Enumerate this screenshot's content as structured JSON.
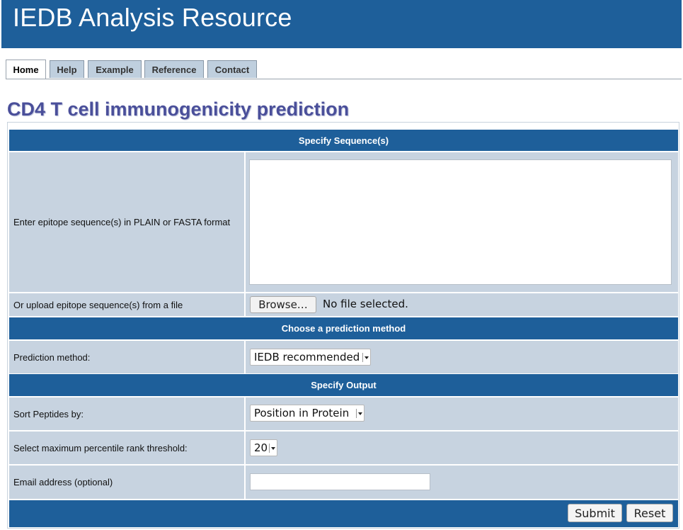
{
  "header": {
    "title": "IEDB Analysis Resource"
  },
  "tabs": [
    {
      "label": "Home",
      "active": true
    },
    {
      "label": "Help",
      "active": false
    },
    {
      "label": "Example",
      "active": false
    },
    {
      "label": "Reference",
      "active": false
    },
    {
      "label": "Contact",
      "active": false
    }
  ],
  "page_title": "CD4 T cell immunogenicity prediction",
  "sections": {
    "sequence": {
      "heading": "Specify Sequence(s)",
      "sequence_label": "Enter epitope sequence(s) in PLAIN or FASTA format",
      "sequence_value": "",
      "upload_label": "Or upload epitope sequence(s) from a file",
      "browse_label": "Browse…",
      "file_status": "No file selected."
    },
    "method": {
      "heading": "Choose a prediction method",
      "label": "Prediction method:",
      "selected": "IEDB recommended"
    },
    "output": {
      "heading": "Specify Output",
      "sort_label": "Sort Peptides by:",
      "sort_selected": "Position in Protein",
      "threshold_label": "Select maximum percentile rank threshold:",
      "threshold_selected": "20",
      "email_label": "Email address (optional)",
      "email_value": ""
    }
  },
  "actions": {
    "submit": "Submit",
    "reset": "Reset"
  },
  "colors": {
    "banner": "#1e5f9a",
    "row_bg": "#c7d3e0",
    "title": "#4a4f9a"
  }
}
